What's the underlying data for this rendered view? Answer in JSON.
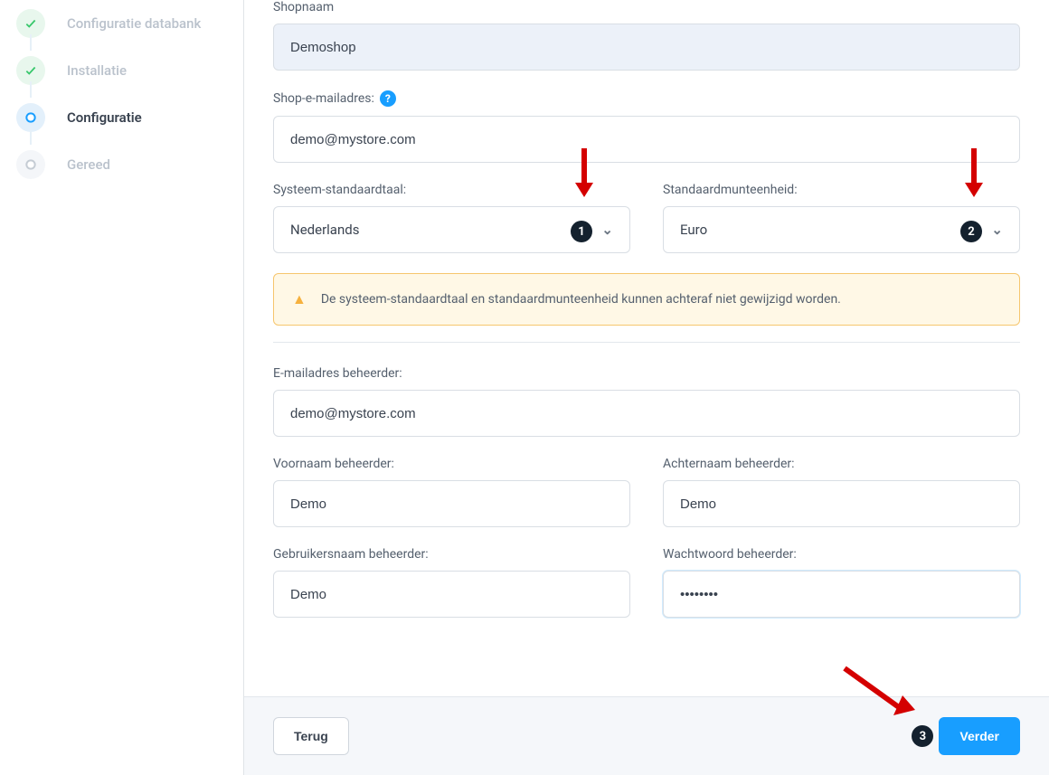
{
  "sidebar": {
    "steps": [
      {
        "label": "Configuratie databank",
        "state": "done"
      },
      {
        "label": "Installatie",
        "state": "done"
      },
      {
        "label": "Configuratie",
        "state": "current"
      },
      {
        "label": "Gereed",
        "state": "future"
      }
    ]
  },
  "form": {
    "shopname_label": "Shopnaam",
    "shopname_value": "Demoshop",
    "shopemail_label": "Shop-e-mailadres:",
    "shopemail_value": "demo@mystore.com",
    "language_label": "Systeem-standaardtaal:",
    "language_value": "Nederlands",
    "currency_label": "Standaardmunteenheid:",
    "currency_value": "Euro",
    "warning_text": "De systeem-standaardtaal en standaardmunteenheid kunnen achteraf niet gewijzigd worden.",
    "admin_email_label": "E-mailadres beheerder:",
    "admin_email_value": "demo@mystore.com",
    "admin_first_label": "Voornaam beheerder:",
    "admin_first_value": "Demo",
    "admin_last_label": "Achternaam beheerder:",
    "admin_last_value": "Demo",
    "admin_user_label": "Gebruikersnaam beheerder:",
    "admin_user_value": "Demo",
    "admin_pass_label": "Wachtwoord beheerder:",
    "admin_pass_value": "••••••••"
  },
  "annotations": {
    "badge1": "1",
    "badge2": "2",
    "badge3": "3"
  },
  "footer": {
    "back_label": "Terug",
    "next_label": "Verder"
  }
}
